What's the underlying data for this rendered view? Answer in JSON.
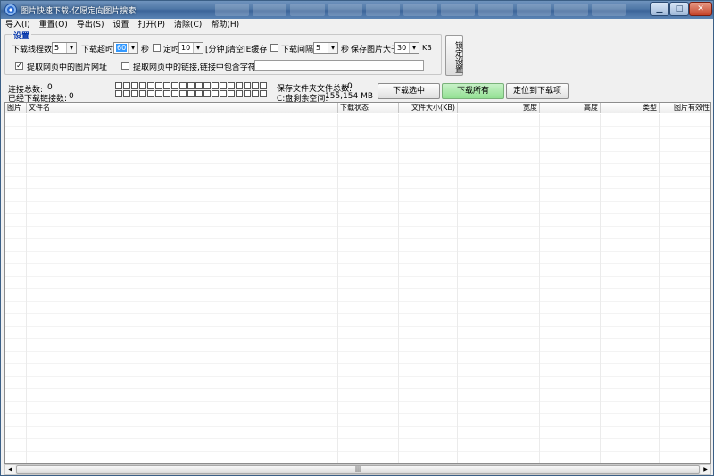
{
  "window": {
    "title": "图片快速下载-亿愿定向图片搜索",
    "controls": {
      "minimize": "▁",
      "maximize": "□",
      "close": "✕"
    }
  },
  "menu": [
    "导入(I)",
    "重置(O)",
    "导出(S)",
    "设置",
    "打开(P)",
    "清除(C)",
    "帮助(H)"
  ],
  "settings": {
    "group_title": "设置",
    "threads_label": "下载线程数",
    "threads_value": "5",
    "timeout_label": "下载超时",
    "timeout_value": "60",
    "timeout_unit": "秒",
    "timer_label": "定时",
    "timer_value": "10",
    "timer_suffix": "[分钟]清空IE缓存",
    "interval_label": "下载间隔",
    "interval_value": "5",
    "interval_unit": "秒",
    "min_size_label": "保存图片大于",
    "min_size_value": "30",
    "min_size_unit": "KB",
    "extract_urls_label": "提取网页中的图片网址",
    "extract_urls_checked": true,
    "extract_links_label": "提取网页中的链接,链接中包含字符:",
    "extract_links_checked": false,
    "extract_links_value": "",
    "lock_button": "锁定设置"
  },
  "stats": {
    "total_links_label": "连接总数:",
    "total_links_value": "0",
    "downloaded_links_label": "已经下载链接数:",
    "downloaded_links_value": "0",
    "saved_files_label": "保存文件夹文件总数:",
    "saved_files_value": "0",
    "free_space_label": "C:盘剩余空间:",
    "free_space_value": "155,154 MB"
  },
  "buttons": {
    "download_selected": "下载选中",
    "download_all": "下载所有",
    "locate_download": "定位到下载项"
  },
  "table": {
    "columns": [
      "图片",
      "文件名",
      "下载状态",
      "文件大小(KB)",
      "宽度",
      "高度",
      "类型",
      "图片有效性"
    ],
    "rows": []
  },
  "colors": {
    "titlebar": "#4f77a6",
    "accent_green": "#93e093",
    "group_title": "#0033aa"
  }
}
